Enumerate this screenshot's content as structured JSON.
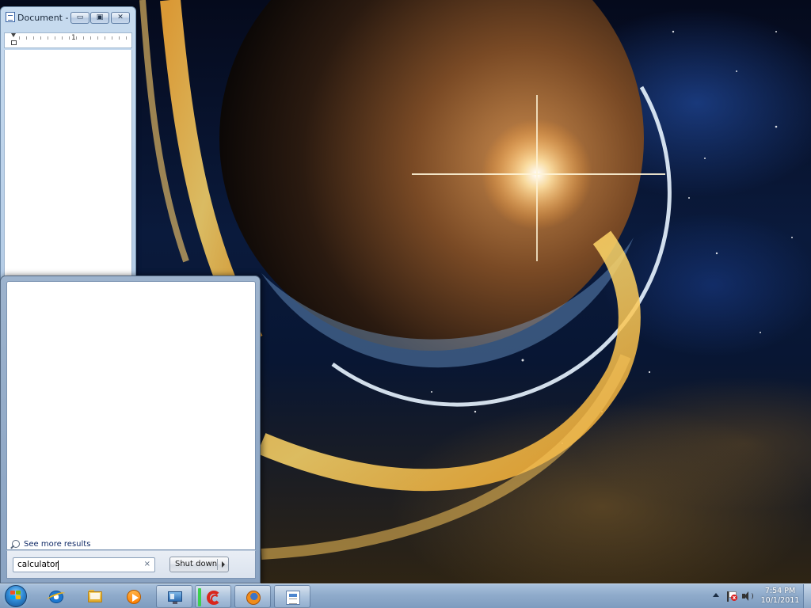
{
  "desktop": {
    "wallpaper": "space-planet",
    "colors": {
      "space": "#07102a",
      "planet_glow": "#ffcf6a",
      "flare": "#ffffff"
    }
  },
  "document_window": {
    "title": "Document - ...",
    "ruler_number": "1",
    "controls": {
      "minimize": "▭",
      "maximize": "▣",
      "close": "✕"
    }
  },
  "start_menu": {
    "see_more_label": "See more results",
    "search": {
      "value": "calculator",
      "clear_glyph": "×"
    },
    "shutdown_label": "Shut down"
  },
  "taskbar": {
    "pinned": [
      {
        "name": "internet-explorer",
        "icon": "ie-icon"
      },
      {
        "name": "windows-explorer",
        "icon": "folder-icon"
      },
      {
        "name": "windows-media-player",
        "icon": "media-icon"
      },
      {
        "name": "remote-desktop",
        "icon": "remote-icon"
      },
      {
        "name": "ccleaner",
        "icon": "ccleaner-icon"
      },
      {
        "name": "firefox",
        "icon": "firefox-icon"
      },
      {
        "name": "wordpad",
        "icon": "notepad-icon"
      }
    ],
    "clock": {
      "time": "7:54 PM",
      "date": "10/1/2011"
    }
  }
}
